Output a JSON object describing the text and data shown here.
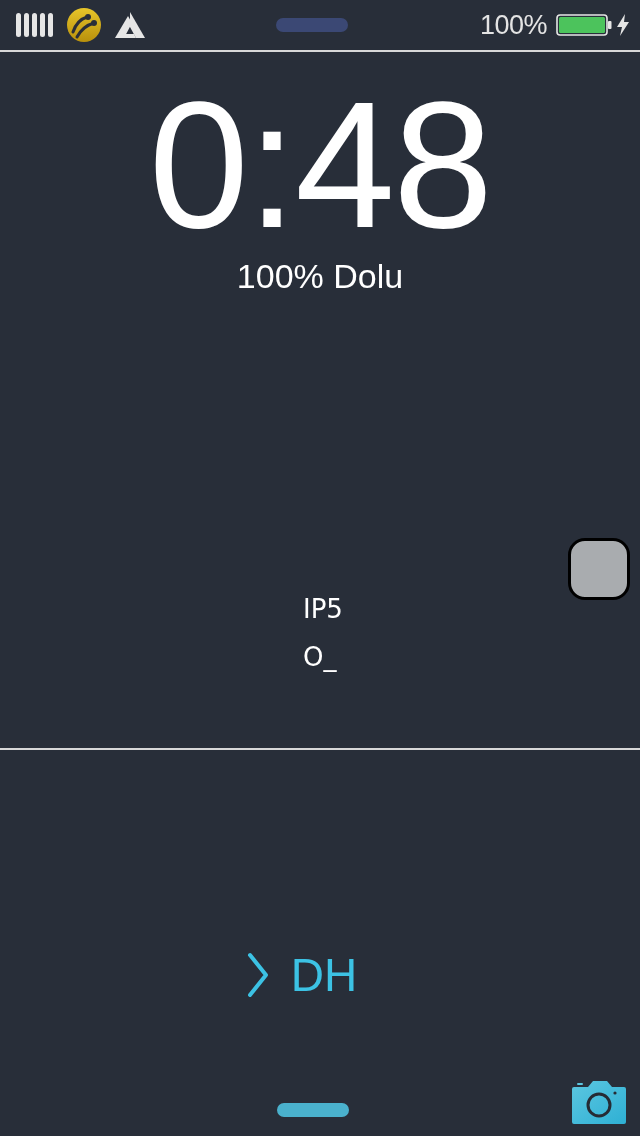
{
  "status_bar": {
    "battery_percent": "100%",
    "battery": {
      "level": 1
    },
    "charging": true
  },
  "clock": {
    "time": "0:48",
    "battery_status": "100% Dolu"
  },
  "widget": {
    "lines": [
      "IP5",
      "O_"
    ]
  },
  "unlock": {
    "label": "DH"
  }
}
